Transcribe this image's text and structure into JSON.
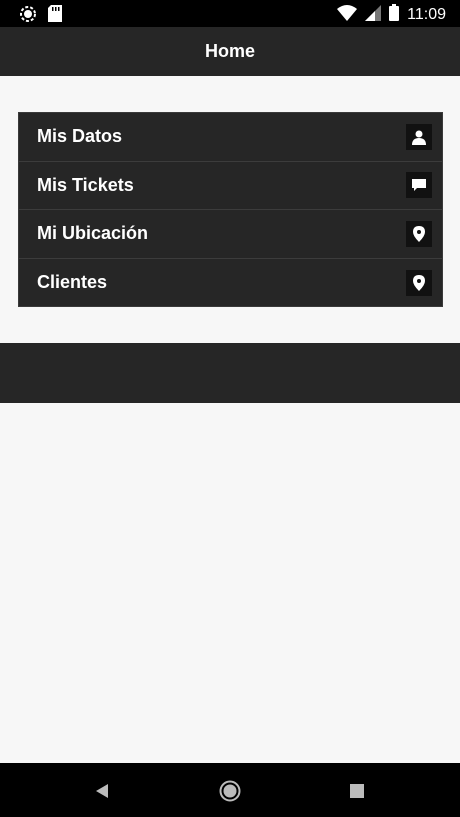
{
  "status_bar": {
    "time": "11:09",
    "icons": [
      "sync-icon",
      "sd-card-icon",
      "wifi-icon",
      "signal-icon",
      "battery-icon"
    ]
  },
  "app_bar": {
    "title": "Home"
  },
  "menu": {
    "items": [
      {
        "label": "Mis Datos",
        "icon": "person-icon"
      },
      {
        "label": "Mis Tickets",
        "icon": "chat-icon"
      },
      {
        "label": "Mi Ubicación",
        "icon": "location-pin-icon"
      },
      {
        "label": "Clientes",
        "icon": "location-pin-icon"
      }
    ]
  },
  "nav_bar": {
    "icons": [
      "back-icon",
      "home-icon",
      "recents-icon"
    ]
  },
  "colors": {
    "bar_dark": "#262626",
    "background": "#f7f7f7",
    "text_light": "#ffffff"
  }
}
